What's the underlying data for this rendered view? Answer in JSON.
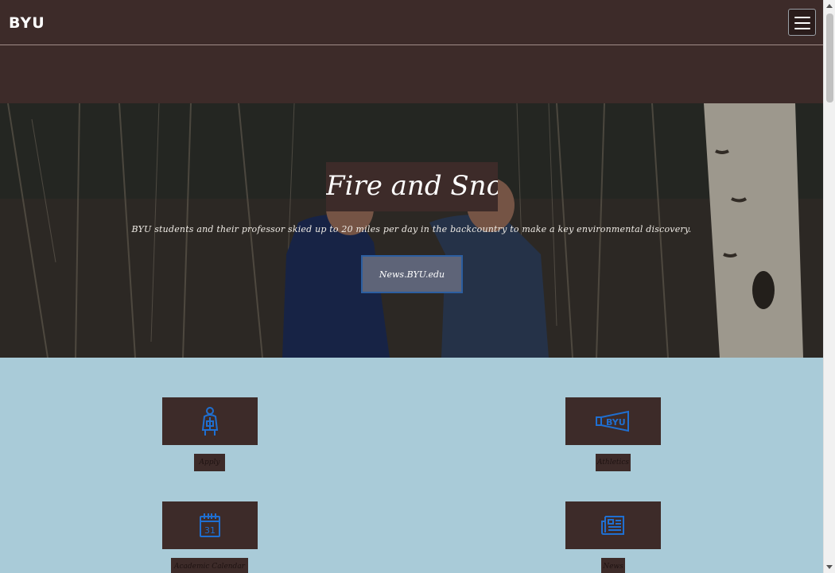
{
  "navbar": {
    "logo": "BYU"
  },
  "hero": {
    "title": "Fire and Snow",
    "subtitle": "BYU students and their professor skied up to 20 miles per day in the backcountry to make a key environmental discovery.",
    "cta_label": "News.BYU.edu"
  },
  "quick_links": [
    {
      "label": "Apply",
      "icon": "graduate-icon"
    },
    {
      "label": "Athletics",
      "icon": "byu-megaphone-icon"
    },
    {
      "label": "Academic Calendar",
      "icon": "calendar-icon"
    },
    {
      "label": "News",
      "icon": "newspaper-icon"
    }
  ],
  "calendar_icon_day": "31",
  "megaphone_icon_text": "BYU",
  "colors": {
    "brand_brown": "#3d2b29",
    "sky_blue": "#a9cbd8",
    "icon_blue": "#1f6fd1"
  }
}
